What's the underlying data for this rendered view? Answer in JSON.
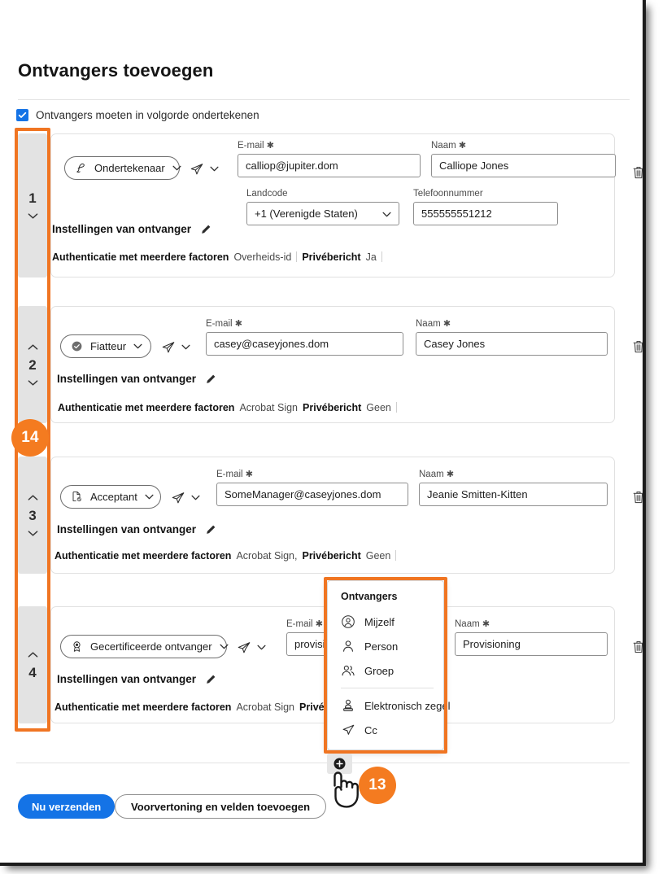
{
  "header": {
    "title": "Ontvangers toevoegen",
    "order_checkbox_label": "Ontvangers moeten in volgorde ondertekenen",
    "order_checkbox_checked": true
  },
  "labels": {
    "email": "E-mail",
    "name": "Naam",
    "country_code": "Landcode",
    "phone": "Telefoonnummer",
    "required_mark": "✱",
    "settings": "Instellingen van ontvanger",
    "auth_label": "Authenticatie met meerdere factoren",
    "private_msg_label": "Privébericht"
  },
  "recipients": [
    {
      "seq": "1",
      "role": "Ondertekenaar",
      "role_icon": "signature-pen-icon",
      "email": "calliop@jupiter.dom",
      "name": "Calliope Jones",
      "country_code": "+1 (Verenigde Staten)",
      "phone": "555555551212",
      "auth_value": "Overheids-id",
      "private_msg_value": "Ja",
      "has_phone": true
    },
    {
      "seq": "2",
      "role": "Fiatteur",
      "role_icon": "check-circle-icon",
      "email": "casey@caseyjones.dom",
      "name": "Casey Jones",
      "auth_value": "Acrobat Sign",
      "private_msg_value": "Geen",
      "has_phone": false
    },
    {
      "seq": "3",
      "role": "Acceptant",
      "role_icon": "document-check-icon",
      "email": "SomeManager@caseyjones.dom",
      "name": "Jeanie Smitten-Kitten",
      "auth_value": "Acrobat Sign,",
      "private_msg_value": "Geen",
      "has_phone": false
    },
    {
      "seq": "4",
      "role": "Gecertificeerde ontvanger",
      "role_icon": "certificate-ribbon-icon",
      "email": "provisi",
      "name": "Provisioning",
      "auth_value": "Acrobat Sign",
      "private_msg_value": "",
      "has_phone": false
    }
  ],
  "popup": {
    "title": "Ontvangers",
    "items": [
      {
        "label": "Mijzelf",
        "icon": "myself-avatar-icon"
      },
      {
        "label": "Person",
        "icon": "person-icon"
      },
      {
        "label": "Groep",
        "icon": "group-icon"
      },
      {
        "label": "Elektronisch zegel",
        "icon": "stamp-icon"
      },
      {
        "label": "Cc",
        "icon": "paper-plane-icon"
      }
    ],
    "divider_after_index": 2
  },
  "footer": {
    "add_button_icon": "plus-circle-icon",
    "send_now": "Nu verzenden",
    "preview_and_add_fields": "Voorvertoning en velden toevoegen"
  },
  "annotations": {
    "badge_left": "14",
    "badge_bottom": "13",
    "highlight_color": "#f07522",
    "badge_color": "#f47b20"
  },
  "colors": {
    "accent_blue": "#1473e6",
    "text_dark": "#1d1d1d",
    "seq_bg": "#e3e3e3"
  }
}
